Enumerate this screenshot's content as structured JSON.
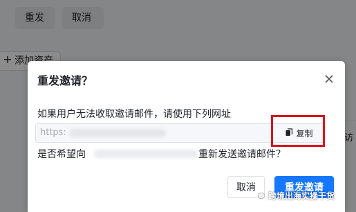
{
  "background": {
    "buttons": {
      "resend_label": "重发",
      "cancel_label": "取消"
    },
    "add_asset_label": "添加资产",
    "right_partial_text": "访"
  },
  "dialog": {
    "title": "重发邀请？",
    "instruction": "如果用户无法收取邀请邮件，请使用下列网址",
    "url_prefix": "https:",
    "copy_label": "复制",
    "question_prefix": "是否希望向",
    "question_suffix": "重新发送邀请邮件？",
    "cancel_label": "取消",
    "confirm_label": "重发邀请"
  },
  "watermark": {
    "text": "跨境出海实操干货"
  },
  "colors": {
    "accent": "#1677ff",
    "highlight": "#d9141c"
  },
  "icons": {
    "close": "close-icon",
    "copy": "copy-icon",
    "add": "plus-icon",
    "watermark": "wechat-icon"
  }
}
